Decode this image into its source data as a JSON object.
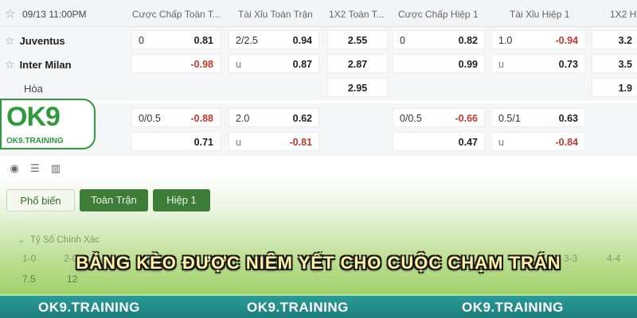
{
  "header": {
    "datetime": "09/13 11:00PM",
    "col1": "Cược Chấp Toàn T...",
    "col2": "Tài Xỉu Toàn Trận",
    "col3": "1X2 Toàn T...",
    "col4": "Cược Chấp Hiệp 1",
    "col5": "Tài Xỉu Hiệp 1",
    "col6": "1X2 H"
  },
  "teams": {
    "home": "Juventus",
    "away": "Inter Milan",
    "draw": "Hòa"
  },
  "row1": {
    "hcap_line": "0",
    "hcap_odd": "0.81",
    "ou_line": "2/2.5",
    "ou_odd": "0.94",
    "x12": "2.55",
    "h1_hcap_line": "0",
    "h1_hcap_odd": "0.82",
    "h1_ou_line": "1.0",
    "h1_ou_odd": "-0.94",
    "h1_x12": "3.2"
  },
  "row2": {
    "hcap_odd": "-0.98",
    "ou_line": "u",
    "ou_odd": "0.87",
    "x12": "2.87",
    "h1_hcap_odd": "0.99",
    "h1_ou_line": "u",
    "h1_ou_odd": "0.73",
    "h1_x12": "3.5"
  },
  "row3": {
    "x12": "2.95",
    "h1_x12": "1.9"
  },
  "row4": {
    "hcap_line": "0/0.5",
    "hcap_odd": "-0.88",
    "ou_line": "2.0",
    "ou_odd": "0.62",
    "h1_hcap_line": "0/0.5",
    "h1_hcap_odd": "-0.66",
    "h1_ou_line": "0.5/1",
    "h1_ou_odd": "0.63"
  },
  "row5": {
    "hcap_odd": "0.71",
    "ou_line": "u",
    "ou_odd": "-0.81",
    "h1_hcap_odd": "0.47",
    "h1_ou_line": "u",
    "h1_ou_odd": "-0.84"
  },
  "tabs": {
    "popular": "Phổ biến",
    "full": "Toàn Trận",
    "half": "Hiệp 1"
  },
  "section": {
    "title": "Tỷ Số Chính Xác"
  },
  "scores": [
    "1-0",
    "2-0",
    "3-3",
    "4-4"
  ],
  "score_odds": [
    "7.5",
    "12"
  ],
  "logo": {
    "text": "OK9",
    "sub": "OK9.TRAINING"
  },
  "banner": "BẢNG KÈO ĐƯỢC NIÊM YẾT CHO CUỘC CHẠM TRÁN",
  "footer": {
    "items": [
      "OK9.TRAINING",
      "OK9.TRAINING",
      "OK9.TRAINING"
    ]
  },
  "colors": {
    "negative": "#c0392b",
    "green": "#2d9a3c",
    "footer": "#1e7f7c"
  }
}
